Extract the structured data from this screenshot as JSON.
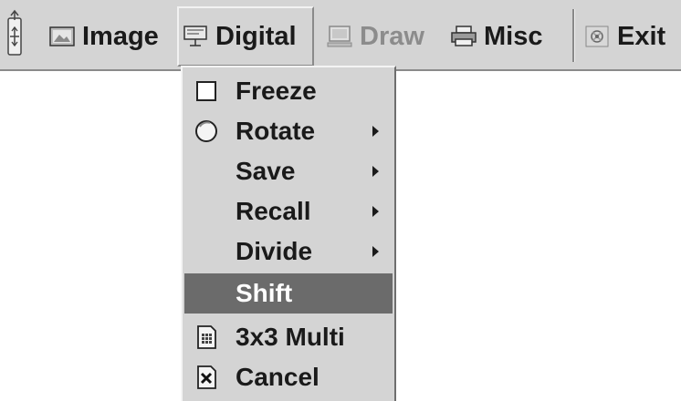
{
  "menubar": {
    "items": [
      {
        "label": "Image",
        "icon": "image-icon"
      },
      {
        "label": "Digital",
        "icon": "digital-display-icon",
        "state": "open"
      },
      {
        "label": "Draw",
        "icon": "draw-monitor-icon",
        "state": "disabled"
      },
      {
        "label": "Misc",
        "icon": "misc-printer-icon"
      },
      {
        "label": "Exit",
        "icon": "exit-icon"
      }
    ]
  },
  "dropdown": {
    "items": [
      {
        "label": "Freeze",
        "icon": "checkbox-icon",
        "submenu": false
      },
      {
        "label": "Rotate",
        "icon": "radio-circle-icon",
        "submenu": true
      },
      {
        "label": "Save",
        "icon": "",
        "submenu": true
      },
      {
        "label": "Recall",
        "icon": "",
        "submenu": true
      },
      {
        "label": "Divide",
        "icon": "",
        "submenu": true
      },
      {
        "label": "Shift",
        "icon": "",
        "submenu": false,
        "state": "highlighted"
      },
      {
        "label": "3x3 Multi",
        "icon": "grid-document-icon",
        "submenu": false
      },
      {
        "label": "Cancel",
        "icon": "cancel-x-icon",
        "submenu": false
      }
    ]
  },
  "colors": {
    "menu_bg": "#d4d4d4",
    "highlight_bg": "#6b6b6b",
    "disabled_text": "#8c8c8c"
  }
}
